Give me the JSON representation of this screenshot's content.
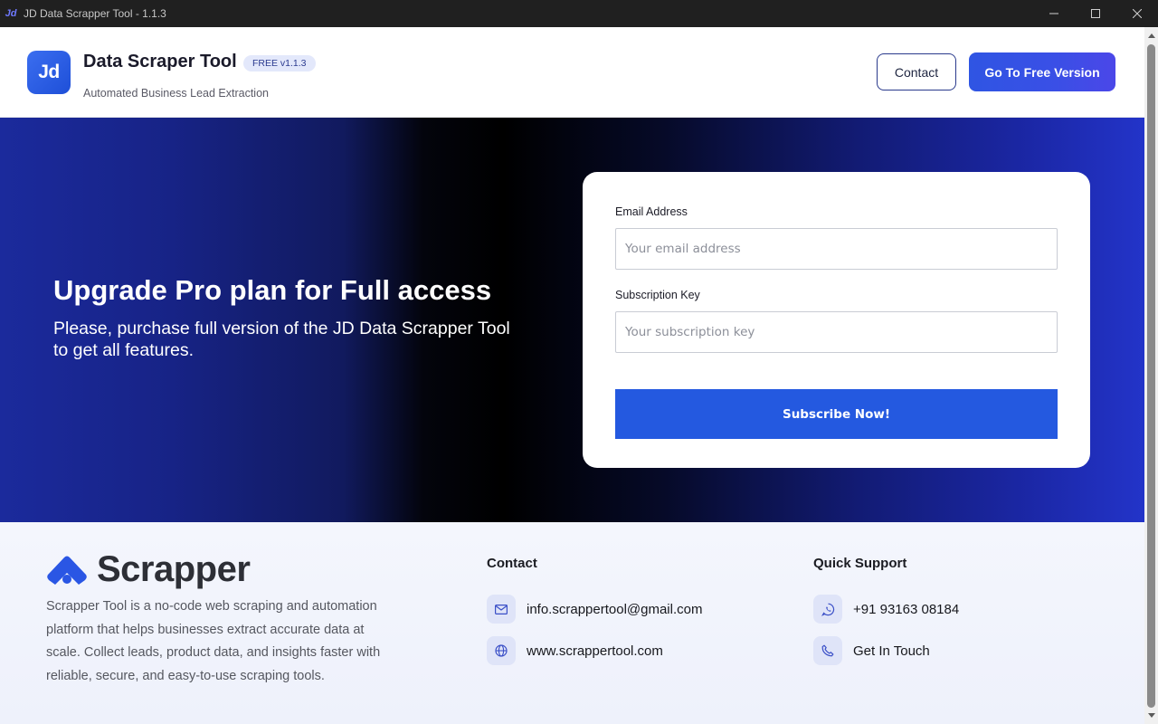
{
  "window": {
    "title": "JD Data Scrapper Tool - 1.1.3",
    "icon_label": "Jd"
  },
  "header": {
    "logo_text": "Jd",
    "brand_name": "Data Scraper Tool",
    "version_badge": "FREE v1.1.3",
    "tagline": "Automated Business Lead Extraction",
    "contact_label": "Contact",
    "free_version_label": "Go To Free Version"
  },
  "hero": {
    "title": "Upgrade Pro plan for Full access",
    "subtitle": "Please, purchase full version of the JD Data Scrapper Tool to get all features."
  },
  "form": {
    "email_label": "Email Address",
    "email_placeholder": "Your email address",
    "email_value": "",
    "key_label": "Subscription Key",
    "key_placeholder": "Your subscription key",
    "key_value": "",
    "submit_label": "Subscribe Now!"
  },
  "footer": {
    "logo_text": "Scrapper",
    "description": "Scrapper Tool is a no-code web scraping and automation platform that helps businesses extract accurate data at scale. Collect leads, product data, and insights faster with reliable, secure, and easy-to-use scraping tools.",
    "contact": {
      "title": "Contact",
      "email": "info.scrappertool@gmail.com",
      "website": "www.scrappertool.com"
    },
    "support": {
      "title": "Quick Support",
      "phone": "+91 93163 08184",
      "get_in_touch": "Get In Touch"
    }
  },
  "colors": {
    "accent": "#2459e0",
    "hero_blue": "#1b2a9c",
    "badge_bg": "#e3e8fb"
  },
  "icons": {
    "email": "mail-icon",
    "website": "globe-icon",
    "phone": "whatsapp-icon",
    "contact": "phone-icon"
  }
}
